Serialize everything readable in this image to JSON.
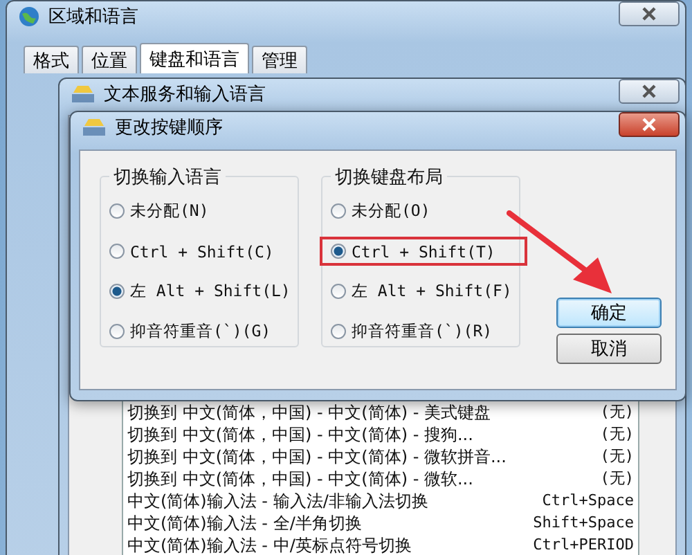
{
  "window": {
    "title": "区域和语言",
    "tabs": [
      {
        "label": "格式",
        "selected": false
      },
      {
        "label": "位置",
        "selected": false
      },
      {
        "label": "键盘和语言",
        "selected": true
      },
      {
        "label": "管理",
        "selected": false
      }
    ]
  },
  "text_services_dialog": {
    "title": "文本服务和输入语言",
    "hotkeys": [
      {
        "action": "切换到 中文(简体，中国) - 中文(简体) - 美式键盘",
        "keys": "(无)"
      },
      {
        "action": "切换到 中文(简体，中国) - 中文(简体) - 搜狗...",
        "keys": "(无)"
      },
      {
        "action": "切换到 中文(简体，中国) - 中文(简体) - 微软拼音...",
        "keys": "(无)"
      },
      {
        "action": "切换到 中文(简体，中国) - 中文(简体) - 微软...",
        "keys": "(无)"
      },
      {
        "action": "中文(简体)输入法 - 输入法/非输入法切换",
        "keys": "Ctrl+Space"
      },
      {
        "action": "中文(简体)输入法 - 全/半角切换",
        "keys": "Shift+Space"
      },
      {
        "action": "中文(简体)输入法 - 中/英标点符号切换",
        "keys": "Ctrl+PERIOD"
      }
    ]
  },
  "change_key_sequence_dialog": {
    "title": "更改按键顺序",
    "groups": [
      {
        "title": "切换输入语言",
        "options": [
          {
            "label": "未分配(N)",
            "selected": false,
            "highlighted": false
          },
          {
            "label": "Ctrl + Shift(C)",
            "selected": false,
            "highlighted": false
          },
          {
            "label": "左 Alt + Shift(L)",
            "selected": true,
            "highlighted": false
          },
          {
            "label": "抑音符重音(`)(G)",
            "selected": false,
            "highlighted": false
          }
        ]
      },
      {
        "title": "切换键盘布局",
        "options": [
          {
            "label": "未分配(O)",
            "selected": false,
            "highlighted": false
          },
          {
            "label": "Ctrl + Shift(T)",
            "selected": true,
            "highlighted": true
          },
          {
            "label": "左 Alt + Shift(F)",
            "selected": false,
            "highlighted": false
          },
          {
            "label": "抑音符重音(`)(R)",
            "selected": false,
            "highlighted": false
          }
        ]
      }
    ],
    "buttons": [
      {
        "label": "确定",
        "default": true
      },
      {
        "label": "取消",
        "default": false
      }
    ]
  }
}
